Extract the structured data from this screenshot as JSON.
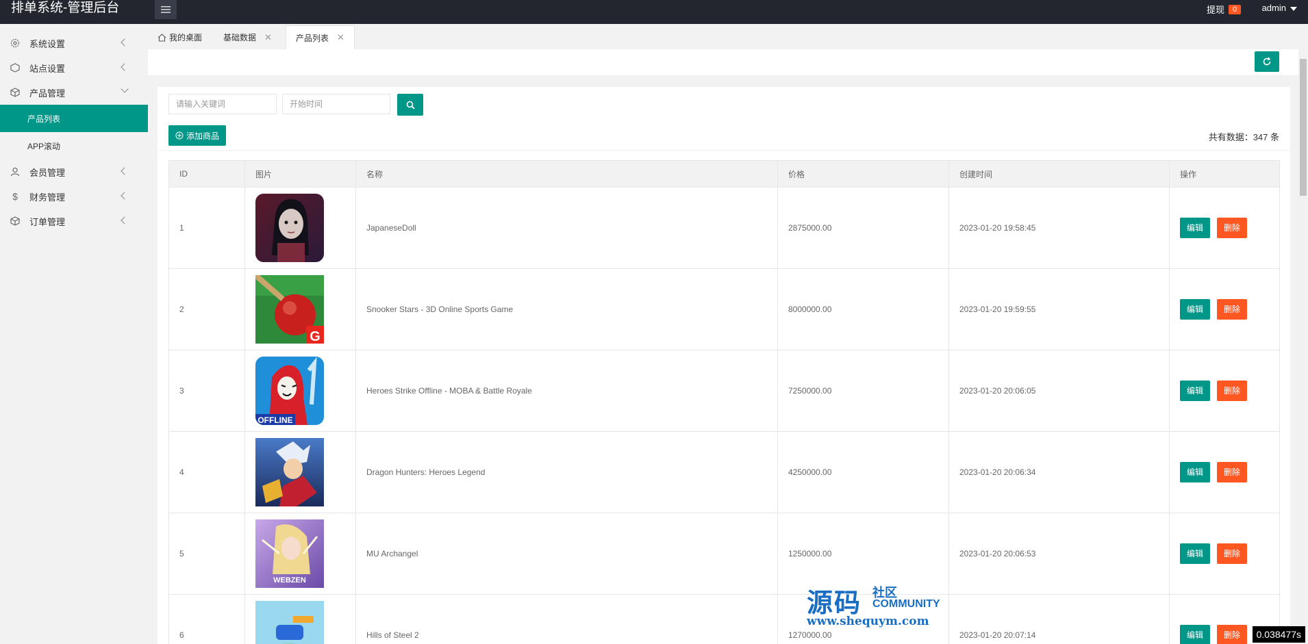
{
  "header": {
    "title": "排单系统-管理后台",
    "withdraw_label": "提现",
    "withdraw_count": "0",
    "user": "admin"
  },
  "sidebar": {
    "items": [
      {
        "label": "系统设置",
        "icon": "gear-icon"
      },
      {
        "label": "站点设置",
        "icon": "box-icon"
      },
      {
        "label": "产品管理",
        "icon": "cube-icon"
      },
      {
        "label": "会员管理",
        "icon": "user-icon"
      },
      {
        "label": "财务管理",
        "icon": "dollar-icon"
      },
      {
        "label": "订单管理",
        "icon": "cube-icon"
      }
    ],
    "sub_items": [
      {
        "label": "产品列表",
        "active": true
      },
      {
        "label": "APP滚动",
        "active": false
      }
    ]
  },
  "tabs": [
    {
      "label": "我的桌面"
    },
    {
      "label": "基础数据"
    },
    {
      "label": "产品列表"
    }
  ],
  "search": {
    "keyword_placeholder": "请输入关键词",
    "date_placeholder": "开始时间"
  },
  "toolbar": {
    "add_label": "添加商品",
    "total_label": "共有数据：347 条"
  },
  "table": {
    "columns": [
      "ID",
      "图片",
      "名称",
      "价格",
      "创建时间",
      "操作"
    ],
    "edit_label": "编辑",
    "delete_label": "删除",
    "rows": [
      {
        "id": "1",
        "name": "JapaneseDoll",
        "price": "2875000.00",
        "created": "2023-01-20 19:58:45"
      },
      {
        "id": "2",
        "name": "Snooker Stars - 3D Online Sports Game",
        "price": "8000000.00",
        "created": "2023-01-20 19:59:55"
      },
      {
        "id": "3",
        "name": "Heroes Strike Offline - MOBA & Battle Royale",
        "price": "7250000.00",
        "created": "2023-01-20 20:06:05"
      },
      {
        "id": "4",
        "name": "Dragon Hunters: Heroes Legend",
        "price": "4250000.00",
        "created": "2023-01-20 20:06:34"
      },
      {
        "id": "5",
        "name": "MU Archangel",
        "price": "1250000.00",
        "created": "2023-01-20 20:06:53"
      },
      {
        "id": "6",
        "name": "Hills of Steel 2",
        "price": "1270000.00",
        "created": "2023-01-20 20:07:14"
      }
    ]
  },
  "thumb_texts": {
    "offline": "OFFLINE",
    "webzen": "WEBZEN",
    "g": "G"
  },
  "watermark": {
    "big": "源码",
    "small": "社区",
    "community": "COMMUNITY",
    "url": "www.shequym.com"
  },
  "timer": "0.038477s",
  "colors": {
    "accent": "#009688",
    "danger": "#ff5722",
    "header": "#23262e"
  }
}
